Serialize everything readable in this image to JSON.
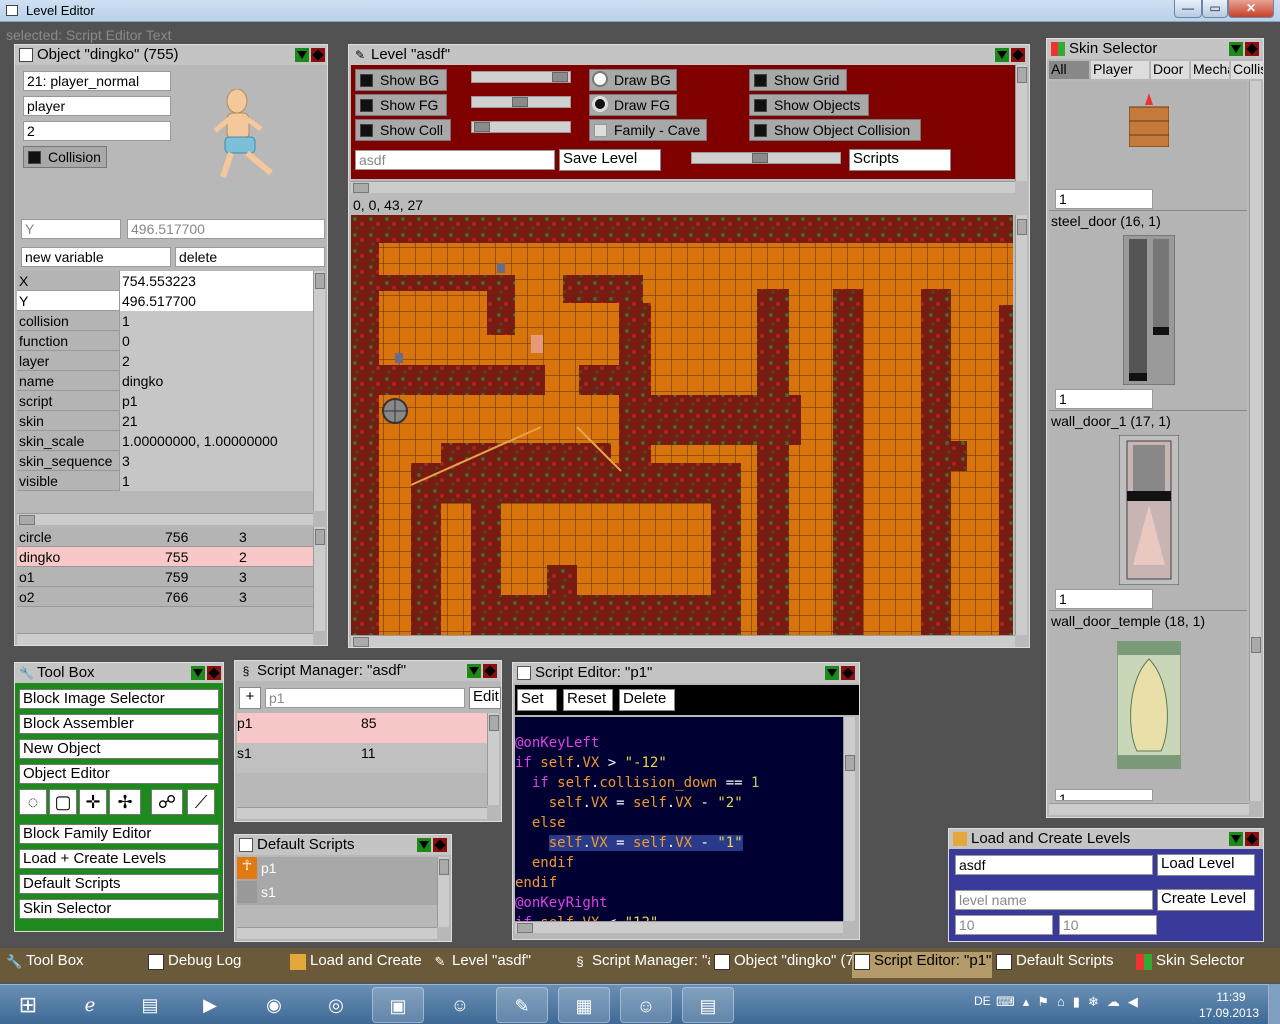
{
  "window": {
    "title": "Level Editor",
    "minimize": "—",
    "maximize": "▭",
    "close": "✕"
  },
  "selected_text": "selected: Script Editor Text",
  "object_panel": {
    "title": "Object \"dingko\" (755)",
    "skin_field": "21: player_normal",
    "type_field": "player",
    "layer_field": "2",
    "collision_label": "Collision",
    "edit_key": "Y",
    "edit_value": "496.517700",
    "new_variable": "new variable",
    "delete_label": "delete",
    "properties": [
      {
        "key": "X",
        "value": "754.553223"
      },
      {
        "key": "Y",
        "value": "496.517700"
      },
      {
        "key": "collision",
        "value": "1"
      },
      {
        "key": "function",
        "value": "0"
      },
      {
        "key": "layer",
        "value": "2"
      },
      {
        "key": "name",
        "value": "dingko"
      },
      {
        "key": "script",
        "value": "p1"
      },
      {
        "key": "skin",
        "value": "21"
      },
      {
        "key": "skin_scale",
        "value": "1.00000000, 1.00000000"
      },
      {
        "key": "skin_sequence",
        "value": "3"
      },
      {
        "key": "visible",
        "value": "1"
      }
    ],
    "objects": [
      {
        "name": "circle",
        "id": "756",
        "layer": "3"
      },
      {
        "name": "dingko",
        "id": "755",
        "layer": "2"
      },
      {
        "name": "o1",
        "id": "759",
        "layer": "3"
      },
      {
        "name": "o2",
        "id": "766",
        "layer": "3"
      }
    ]
  },
  "level_panel": {
    "title": "Level \"asdf\"",
    "show_bg": "Show BG",
    "show_fg": "Show FG",
    "show_coll": "Show Coll",
    "draw_bg": "Draw BG",
    "draw_fg": "Draw FG",
    "family": "Family - Cave",
    "show_grid": "Show Grid",
    "show_objects": "Show Objects",
    "show_object_collision": "Show Object Collision",
    "level_name": "asdf",
    "save_level": "Save Level",
    "scripts": "Scripts",
    "coords": "0, 0, 43, 27"
  },
  "skin_selector": {
    "title": "Skin Selector",
    "tabs": [
      "All",
      "Player",
      "Door",
      "Mecha",
      "Collisi"
    ],
    "items": [
      {
        "label": "",
        "count": "1"
      },
      {
        "label": "steel_door (16, 1)",
        "count": "1"
      },
      {
        "label": "wall_door_1 (17, 1)",
        "count": "1"
      },
      {
        "label": "wall_door_temple (18, 1)",
        "count": "1"
      }
    ]
  },
  "toolbox": {
    "title": "Tool Box",
    "buttons_top": [
      "Block Image Selector",
      "Block Assembler",
      "New Object",
      "Object Editor"
    ],
    "tools": [
      "lasso-tool",
      "select-tool",
      "move-tool",
      "pivot-tool",
      "people-tool",
      "line-tool"
    ],
    "buttons_bottom": [
      "Block Family Editor",
      "Load + Create Levels",
      "Default Scripts",
      "Skin Selector"
    ]
  },
  "script_manager": {
    "title": "Script Manager: \"asdf\"",
    "add": "+",
    "field": "p1",
    "edit": "Edit",
    "rows": [
      {
        "name": "p1",
        "lines": "85"
      },
      {
        "name": "s1",
        "lines": "11"
      }
    ]
  },
  "default_scripts": {
    "title": "Default Scripts",
    "rows": [
      "p1",
      "s1"
    ]
  },
  "script_editor": {
    "title": "Script Editor: \"p1\"",
    "set": "Set",
    "reset": "Reset",
    "delete": "Delete"
  },
  "load_create": {
    "title": "Load and Create Levels",
    "level_field": "asdf",
    "load_level": "Load Level",
    "name_placeholder": "level name",
    "create_level": "Create Level",
    "w": "10",
    "h": "10"
  },
  "tabs_bar": [
    {
      "label": "Tool Box",
      "icon": "wrench-icon"
    },
    {
      "label": "Debug Log",
      "icon": "log-icon"
    },
    {
      "label": "Load and Create L",
      "icon": "folder-icon"
    },
    {
      "label": "Level \"asdf\"",
      "icon": "pencil-icon"
    },
    {
      "label": "Script Manager: \"a",
      "icon": "script-icon"
    },
    {
      "label": "Object \"dingko\" (7",
      "icon": "object-icon"
    },
    {
      "label": "Script Editor: \"p1\"",
      "icon": "editor-icon"
    },
    {
      "label": "Default Scripts",
      "icon": "doc-icon"
    },
    {
      "label": "Skin Selector",
      "icon": "palette-icon"
    }
  ],
  "system_tray": {
    "lang": "DE",
    "time": "11:39",
    "date": "17.09.2013"
  },
  "colors": {
    "level_bg": "#800000",
    "tile_orange": "#d8740c",
    "tile_red": "#7a1a12",
    "editor_bg": "#000033"
  }
}
